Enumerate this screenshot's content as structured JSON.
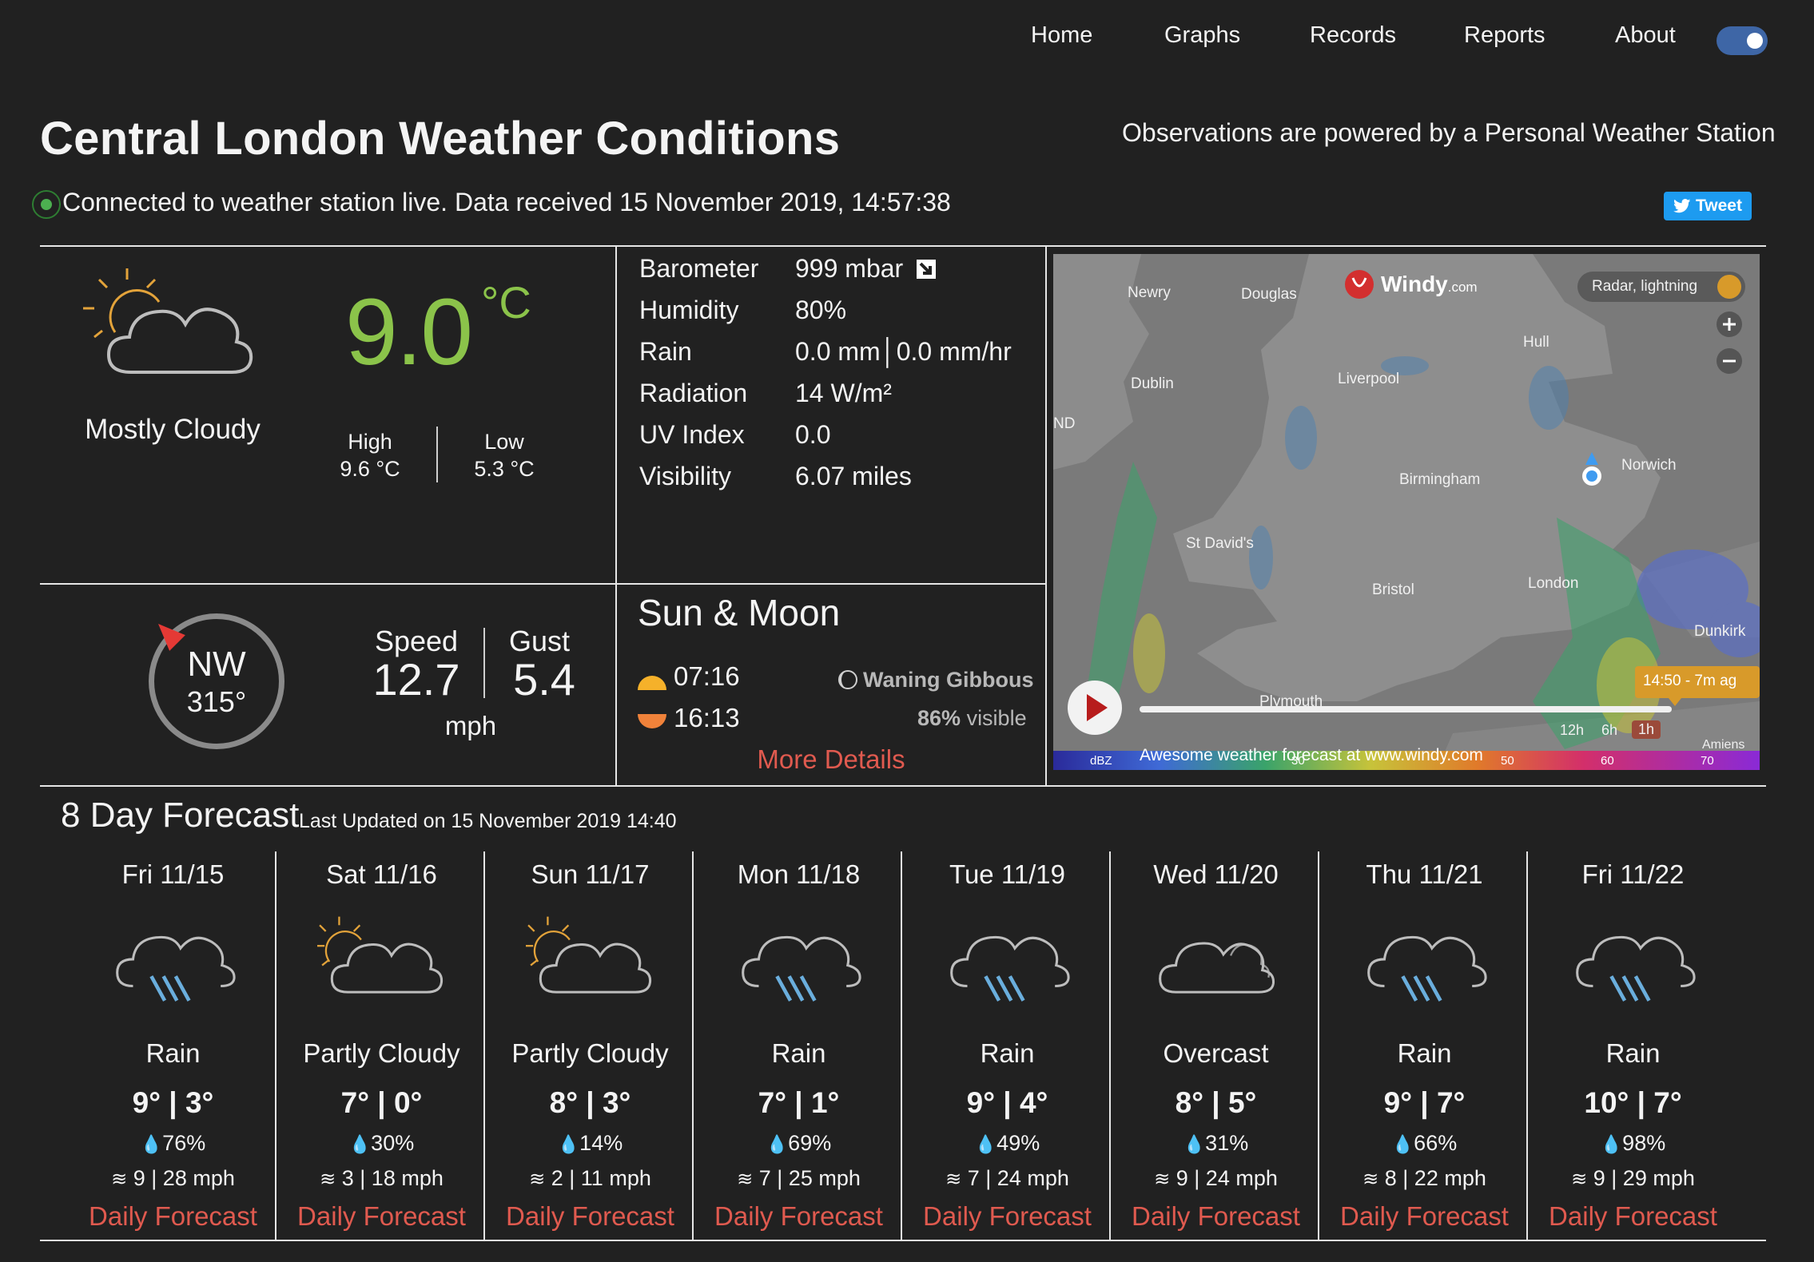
{
  "nav": {
    "items": [
      "Home",
      "Graphs",
      "Records",
      "Reports",
      "About"
    ]
  },
  "header": {
    "title": "Central London Weather Conditions",
    "powered": "Observations are powered by a Personal Weather Station",
    "status": "Connected to weather station live. Data received 15 November 2019, 14:57:38",
    "tweet": "Tweet"
  },
  "current": {
    "condition": "Mostly Cloudy",
    "temp": "9.0",
    "unit": "°C",
    "high_label": "High",
    "high": "9.6 °C",
    "low_label": "Low",
    "low": "5.3 °C"
  },
  "stats": [
    {
      "label": "Barometer",
      "value": "999 mbar"
    },
    {
      "label": "Humidity",
      "value": "80%"
    },
    {
      "label": "Rain",
      "value": "0.0 mm│0.0 mm/hr"
    },
    {
      "label": "Radiation",
      "value": "14 W/m²"
    },
    {
      "label": "UV Index",
      "value": "0.0"
    },
    {
      "label": "Visibility",
      "value": "6.07 miles"
    }
  ],
  "wind": {
    "direction": "NW",
    "degrees": "315°",
    "speed_label": "Speed",
    "speed": "12.7",
    "gust_label": "Gust",
    "gust": "5.4",
    "unit": "mph"
  },
  "sun_moon": {
    "title": "Sun & Moon",
    "sunrise": "07:16",
    "sunset": "16:13",
    "moon_phase": "Waning Gibbous",
    "visible_pct": "86%",
    "visible_label": "visible",
    "more": "More Details"
  },
  "map": {
    "brand": "Windy",
    "brand_suffix": ".com",
    "layer": "Radar, lightning",
    "places": [
      "Newry",
      "Douglas",
      "Hull",
      "Dublin",
      "Liverpool",
      "ND",
      "Birmingham",
      "Norwich",
      "St David's",
      "Bristol",
      "London",
      "Dunkirk",
      "Plymouth",
      "Amiens"
    ],
    "time_badge": "14:50 - 7m ag",
    "ranges": [
      "12h",
      "6h",
      "1h"
    ],
    "footer": "Awesome weather forecast at www.windy.com",
    "scale_unit": "dBZ",
    "scale_ticks": [
      "30",
      "50",
      "60",
      "70"
    ]
  },
  "forecast": {
    "title": "8 Day Forecast",
    "updated": "Last Updated on 15 November 2019 14:40",
    "days": [
      {
        "name": "Fri 11/15",
        "icon": "rain",
        "cond": "Rain",
        "temp": "9° | 3°",
        "precip": "76%",
        "wind": "9 | 28 mph",
        "link": "Daily Forecast"
      },
      {
        "name": "Sat 11/16",
        "icon": "partly-cloudy",
        "cond": "Partly Cloudy",
        "temp": "7° | 0°",
        "precip": "30%",
        "wind": "3 | 18 mph",
        "link": "Daily Forecast"
      },
      {
        "name": "Sun 11/17",
        "icon": "partly-cloudy",
        "cond": "Partly Cloudy",
        "temp": "8° | 3°",
        "precip": "14%",
        "wind": "2 | 11 mph",
        "link": "Daily Forecast"
      },
      {
        "name": "Mon 11/18",
        "icon": "rain",
        "cond": "Rain",
        "temp": "7° | 1°",
        "precip": "69%",
        "wind": "7 | 25 mph",
        "link": "Daily Forecast"
      },
      {
        "name": "Tue 11/19",
        "icon": "rain",
        "cond": "Rain",
        "temp": "9° | 4°",
        "precip": "49%",
        "wind": "7 | 24 mph",
        "link": "Daily Forecast"
      },
      {
        "name": "Wed 11/20",
        "icon": "overcast",
        "cond": "Overcast",
        "temp": "8° | 5°",
        "precip": "31%",
        "wind": "9 | 24 mph",
        "link": "Daily Forecast"
      },
      {
        "name": "Thu 11/21",
        "icon": "rain",
        "cond": "Rain",
        "temp": "9° | 7°",
        "precip": "66%",
        "wind": "8 | 22 mph",
        "link": "Daily Forecast"
      },
      {
        "name": "Fri 11/22",
        "icon": "rain",
        "cond": "Rain",
        "temp": "10° | 7°",
        "precip": "98%",
        "wind": "9 | 29 mph",
        "link": "Daily Forecast"
      }
    ]
  },
  "colors": {
    "temp": "#8bc34a",
    "link": "#e05a4f",
    "accent": "#3e66a6",
    "map_accent": "#d89a2a"
  }
}
